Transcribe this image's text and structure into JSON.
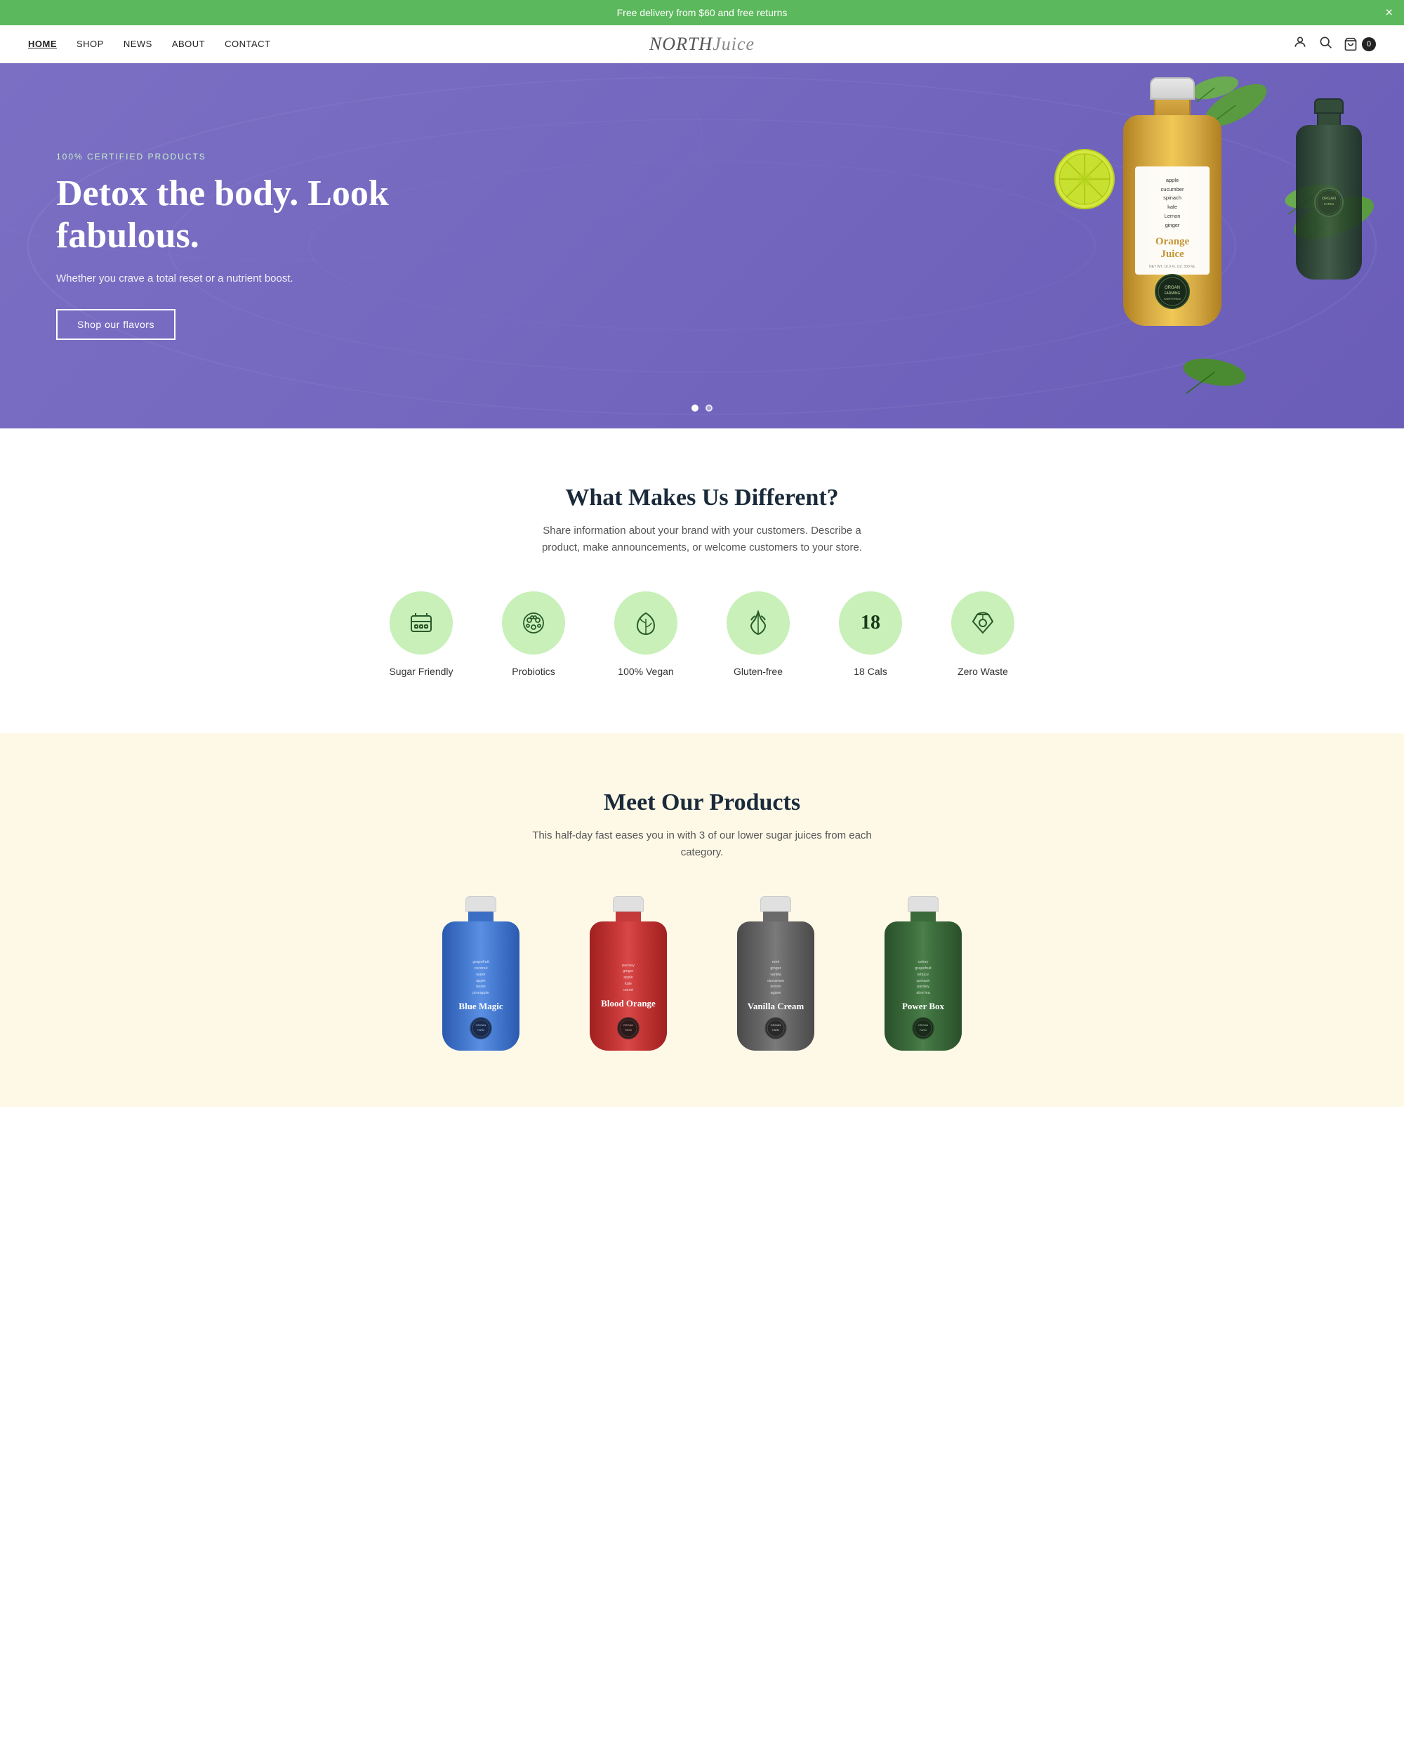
{
  "announcement": {
    "text": "Free delivery from $60 and free returns",
    "close_label": "×"
  },
  "nav": {
    "logo_main": "NORTH",
    "logo_italic": "Juice",
    "links": [
      {
        "label": "HOME",
        "active": true,
        "id": "home"
      },
      {
        "label": "SHOP",
        "active": false,
        "id": "shop"
      },
      {
        "label": "NEWS",
        "active": false,
        "id": "news"
      },
      {
        "label": "ABOUT",
        "active": false,
        "id": "about"
      },
      {
        "label": "CONTACT",
        "active": false,
        "id": "contact"
      }
    ],
    "cart_count": "0"
  },
  "hero": {
    "certified_label": "100% CERTIFIED PRODUCTS",
    "headline": "Detox the body. Look fabulous.",
    "subtitle": "Whether you crave a total reset or a nutrient boost.",
    "cta_label": "Shop our flavors",
    "bottle_ingredients": "apple\ncucumber\nspinach\nkale\nLemon\nginger",
    "bottle_name": "Orange Juice",
    "slide_count": 2,
    "current_slide": 1
  },
  "features": {
    "title": "What Makes Us Different?",
    "subtitle": "Share information about your brand with your customers. Describe a product, make announcements, or welcome customers to your store.",
    "items": [
      {
        "icon": "🧃",
        "label": "Sugar Friendly",
        "id": "sugar-friendly"
      },
      {
        "icon": "🌿",
        "label": "Probiotics",
        "id": "probiotics"
      },
      {
        "icon": "🌱",
        "label": "100% Vegan",
        "id": "vegan"
      },
      {
        "icon": "🌾",
        "label": "Gluten-free",
        "id": "gluten-free"
      },
      {
        "icon_text": "18",
        "label": "18 Cals",
        "id": "calories"
      },
      {
        "icon": "♻",
        "label": "Zero Waste",
        "id": "zero-waste"
      }
    ]
  },
  "products": {
    "title": "Meet Our Products",
    "subtitle": "This half-day fast eases you in with 3 of our lower sugar juices from each category.",
    "items": [
      {
        "id": "blue-magic",
        "name": "Blue Magic",
        "color_class": "prod-blue",
        "ingredients": "grapefruit\ncoconut\nwater\napple\nbeets\npineapple"
      },
      {
        "id": "blood-orange",
        "name": "Blood Orange",
        "color_class": "prod-red",
        "ingredients": "parsley\nginger\napple\nkale\ncarrot"
      },
      {
        "id": "vanilla-cream",
        "name": "Vanilla Cream",
        "color_class": "prod-gray",
        "ingredients": "mint\nginger\nvanilla\ncinnamon\nlemon\nagave"
      },
      {
        "id": "power-box",
        "name": "Power Box",
        "color_class": "prod-green",
        "ingredients": "celery\ngrapefruit\nlettuce\nspinach\nparsley\naloe lea"
      }
    ]
  },
  "colors": {
    "announcement_bg": "#5cb85c",
    "hero_bg": "#7b6fc4",
    "feature_icon_bg": "#c8f0b8",
    "products_section_bg": "#fef9e7"
  }
}
